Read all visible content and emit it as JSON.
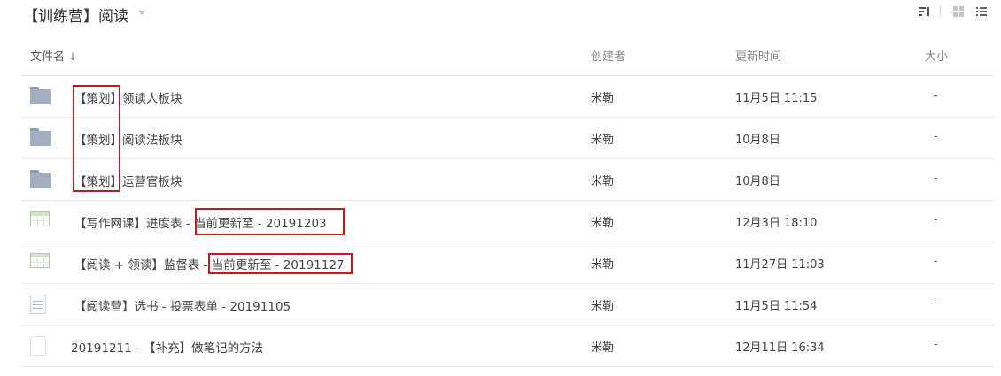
{
  "header": {
    "title": "【训练营】阅读",
    "title_dropdown_icon": "caret-down-icon",
    "view_icons": [
      "sort-icon",
      "grid-view-icon",
      "list-view-icon"
    ]
  },
  "columns": {
    "name": "文件名",
    "name_sort_indicator": "↓",
    "creator": "创建者",
    "updated": "更新时间",
    "size": "大小"
  },
  "files": [
    {
      "icon": "folder-icon",
      "name": "【策划】领读人板块",
      "creator": "米勒",
      "updated": "11月5日 11:15",
      "size": "-"
    },
    {
      "icon": "folder-icon",
      "name": "【策划】阅读法板块",
      "creator": "米勒",
      "updated": "10月8日",
      "size": "-"
    },
    {
      "icon": "folder-icon",
      "name": "【策划】运营官板块",
      "creator": "米勒",
      "updated": "10月8日",
      "size": "-"
    },
    {
      "icon": "spreadsheet-icon",
      "name": "【写作网课】进度表 - 当前更新至 - 20191203",
      "creator": "米勒",
      "updated": "12月3日 18:10",
      "size": "-"
    },
    {
      "icon": "spreadsheet-icon",
      "name": "【阅读 + 领读】监督表 - 当前更新至 - 20191127",
      "creator": "米勒",
      "updated": "11月27日 11:03",
      "size": "-"
    },
    {
      "icon": "form-icon",
      "name": "【阅读营】选书 - 投票表单 - 20191105",
      "creator": "米勒",
      "updated": "11月5日 11:54",
      "size": "-"
    },
    {
      "icon": "document-icon",
      "name": "20191211 - 【补充】做笔记的方法",
      "creator": "米勒",
      "updated": "12月11日 16:34",
      "size": "-"
    }
  ],
  "colors": {
    "annotation_red": "#d0141c",
    "folder": "#a3aec0"
  }
}
